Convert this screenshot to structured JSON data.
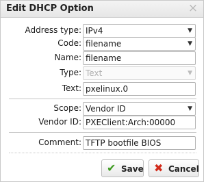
{
  "dialog": {
    "title": "Edit DHCP Option",
    "close_icon": "×"
  },
  "fields": {
    "address_type": {
      "label": "Address type:",
      "value": "IPv4"
    },
    "code": {
      "label": "Code:",
      "value": "filename"
    },
    "name": {
      "label": "Name:",
      "value": "filename"
    },
    "type": {
      "label": "Type:",
      "value": "Text"
    },
    "text": {
      "label": "Text:",
      "value": "pxelinux.0"
    },
    "scope": {
      "label": "Scope:",
      "value": "Vendor ID"
    },
    "vendor_id": {
      "label": "Vendor ID:",
      "value": "PXEClient:Arch:00000"
    },
    "comment": {
      "label": "Comment:",
      "value": "TFTP bootfile BIOS"
    }
  },
  "buttons": {
    "save_label": "Save",
    "save_icon": "check-icon",
    "cancel_label": "Cancel",
    "cancel_icon": "cross-icon"
  },
  "colors": {
    "save_icon": "#3c9a1e",
    "cancel_icon": "#d22a1a"
  }
}
